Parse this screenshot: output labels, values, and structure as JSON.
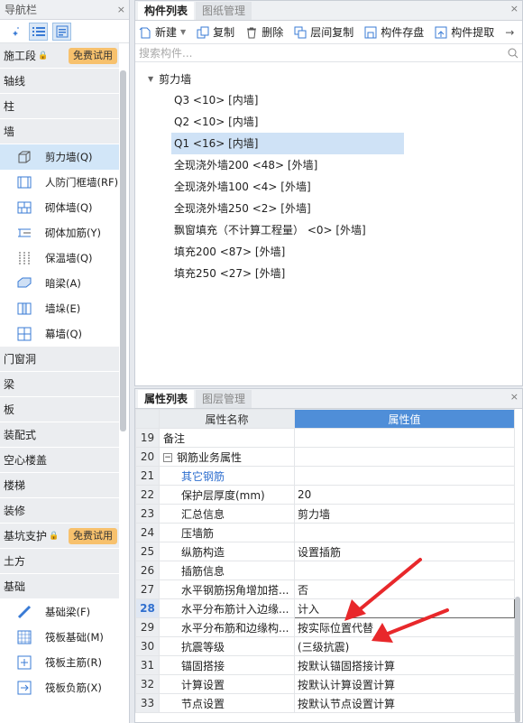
{
  "nav": {
    "title": "导航栏",
    "close": "×",
    "badge": "免费试用",
    "cats": {
      "c1": "施工段",
      "c2": "轴线",
      "c3": "柱",
      "c4": "墙",
      "c5": "门窗洞",
      "c6": "梁",
      "c7": "板",
      "c8": "装配式",
      "c9": "空心楼盖",
      "c10": "楼梯",
      "c11": "装修",
      "c12": "基坑支护",
      "c13": "土方",
      "c14": "基础"
    },
    "wall_items": [
      "剪力墙(Q)",
      "人防门框墙(RF)",
      "砌体墙(Q)",
      "砌体加筋(Y)",
      "保温墙(Q)",
      "暗梁(A)",
      "墙垛(E)",
      "幕墙(Q)"
    ],
    "found_items": [
      "基础梁(F)",
      "筏板基础(M)",
      "筏板主筋(R)",
      "筏板负筋(X)"
    ]
  },
  "comp": {
    "tab1": "构件列表",
    "tab2": "图纸管理",
    "close": "×",
    "toolbar": {
      "new": "新建",
      "copy": "复制",
      "delete": "删除",
      "floor_copy": "层间复制",
      "save": "构件存盘",
      "extract": "构件提取"
    },
    "search_placeholder": "搜索构件...",
    "root": "剪力墙",
    "nodes": [
      "Q3 <10> [内墙]",
      "Q2 <10> [内墙]",
      "Q1 <16> [内墙]",
      "全现浇外墙200 <48> [外墙]",
      "全现浇外墙100 <4> [外墙]",
      "全现浇外墙250 <2> [外墙]",
      "飘窗填充（不计算工程量） <0> [外墙]",
      "填充200 <87> [外墙]",
      "填充250 <27> [外墙]"
    ]
  },
  "props": {
    "tab1": "属性列表",
    "tab2": "图层管理",
    "close": "×",
    "col_name": "属性名称",
    "col_val": "属性值",
    "rows": [
      {
        "n": "19",
        "name": "备注",
        "val": ""
      },
      {
        "n": "20",
        "name": "钢筋业务属性",
        "val": ""
      },
      {
        "n": "21",
        "name": "其它钢筋",
        "val": ""
      },
      {
        "n": "22",
        "name": "保护层厚度(mm)",
        "val": "20"
      },
      {
        "n": "23",
        "name": "汇总信息",
        "val": "剪力墙"
      },
      {
        "n": "24",
        "name": "压墙筋",
        "val": ""
      },
      {
        "n": "25",
        "name": "纵筋构造",
        "val": "设置插筋"
      },
      {
        "n": "26",
        "name": "插筋信息",
        "val": ""
      },
      {
        "n": "27",
        "name": "水平钢筋拐角增加搭...",
        "val": "否"
      },
      {
        "n": "28",
        "name": "水平分布筋计入边缘...",
        "val": "计入"
      },
      {
        "n": "29",
        "name": "水平分布筋和边缘构...",
        "val": "按实际位置代替"
      },
      {
        "n": "30",
        "name": "抗震等级",
        "val": "(三级抗震)"
      },
      {
        "n": "31",
        "name": "锚固搭接",
        "val": "按默认锚固搭接计算"
      },
      {
        "n": "32",
        "name": "计算设置",
        "val": "按默认计算设置计算"
      },
      {
        "n": "33",
        "name": "节点设置",
        "val": "按默认节点设置计算"
      }
    ]
  },
  "colors": {
    "accent": "#4f8ed8",
    "badge": "#f7c16d",
    "arrow": "#e8282b",
    "selection": "#cfe2f6"
  }
}
